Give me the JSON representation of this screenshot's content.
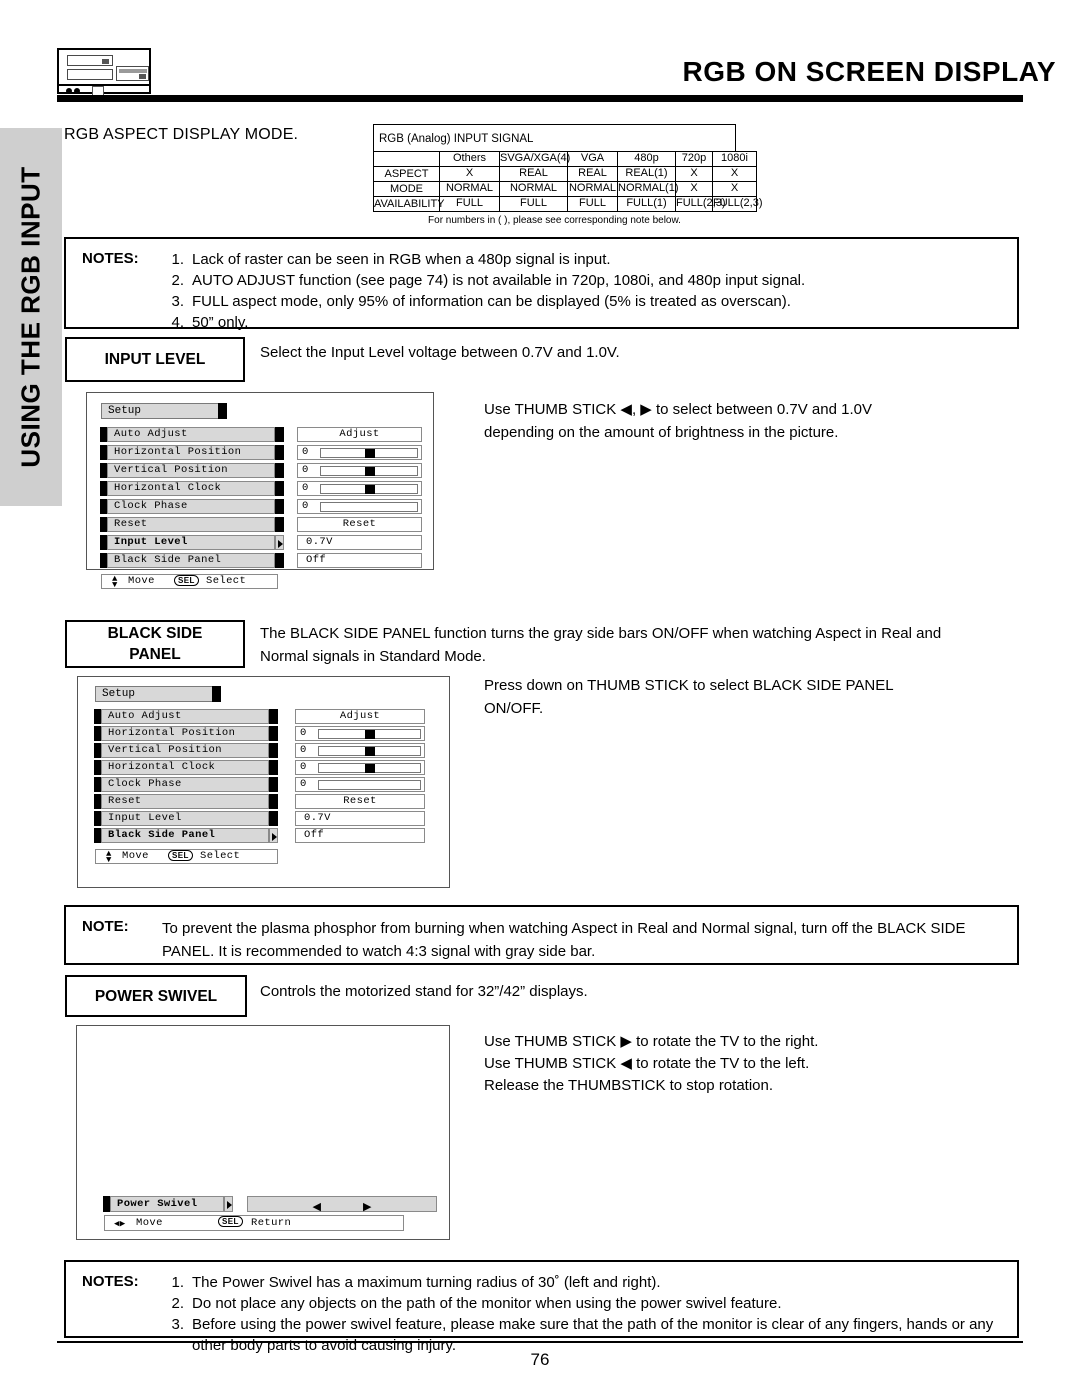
{
  "header": {
    "title": "RGB ON SCREEN DISPLAY",
    "logo_icon": "vcr-deck-icon"
  },
  "sidebar": {
    "tab_label": "USING THE RGB INPUT"
  },
  "aspect_heading": "RGB ASPECT DISPLAY MODE.",
  "signal_table": {
    "title": "RGB (Analog) INPUT SIGNAL",
    "row_label": "ASPECT\nMODE\nAVAILABILITY",
    "row_label_lines": [
      "ASPECT",
      "MODE",
      "AVAILABILITY"
    ],
    "columns": [
      "Others",
      "SVGA/XGA(4)",
      "VGA",
      "480p",
      "720p",
      "1080i"
    ],
    "rows": [
      [
        "X",
        "REAL",
        "REAL",
        "REAL(1)",
        "X",
        "X"
      ],
      [
        "NORMAL",
        "NORMAL",
        "NORMAL",
        "NORMAL(1)",
        "X",
        "X"
      ],
      [
        "FULL",
        "FULL",
        "FULL",
        "FULL(1)",
        "FULL(2,3)",
        "FULL(2,3)"
      ]
    ],
    "footnote": "For numbers in ( ), please see corresponding note below."
  },
  "top_notes": {
    "label": "NOTES:",
    "items": [
      {
        "num": "1.",
        "text": "Lack of raster can be seen in RGB when a 480p signal is input."
      },
      {
        "num": "2.",
        "text": "AUTO ADJUST function (see page 74) is not available in 720p, 1080i, and 480p input signal."
      },
      {
        "num": "3.",
        "text": "FULL aspect mode, only 95% of information can be displayed (5% is treated as overscan)."
      },
      {
        "num": "4.",
        "text": "50” only."
      }
    ]
  },
  "input_level": {
    "label": "INPUT LEVEL",
    "desc": "Select the Input Level voltage between 0.7V and 1.0V.",
    "instruction": "Use THUMB STICK ◀, ▶ to select between 0.7V and 1.0V depending on the amount of brightness in the picture.",
    "osd": {
      "title": "Setup",
      "rows": [
        {
          "label": "Auto Adjust",
          "type": "text",
          "value": "Adjust",
          "selected": false,
          "arrow": false
        },
        {
          "label": "Horizontal Position",
          "type": "slider",
          "value": "0",
          "thumb": 48,
          "selected": false,
          "arrow": false
        },
        {
          "label": "Vertical Position",
          "type": "slider",
          "value": "0",
          "thumb": 48,
          "selected": false,
          "arrow": false
        },
        {
          "label": "Horizontal Clock",
          "type": "slider",
          "value": "0",
          "thumb": 48,
          "selected": false,
          "arrow": false
        },
        {
          "label": "Clock Phase",
          "type": "slider",
          "value": "0",
          "thumb": -1,
          "selected": false,
          "arrow": false
        },
        {
          "label": "Reset",
          "type": "text",
          "value": "Reset",
          "selected": false,
          "arrow": false
        },
        {
          "label": "Input Level",
          "type": "text",
          "value": "0.7V",
          "selected": true,
          "arrow": true
        },
        {
          "label": "Black Side Panel",
          "type": "text",
          "value": "Off",
          "selected": false,
          "arrow": false
        }
      ],
      "footer_move": "Move",
      "footer_key": "SEL",
      "footer_action": "Select"
    }
  },
  "black_side_panel": {
    "label_line1": "BLACK SIDE",
    "label_line2": "PANEL",
    "desc": "The BLACK SIDE PANEL function turns the gray side bars ON/OFF when watching Aspect in Real and Normal signals in Standard Mode.",
    "instruction": "Press down on THUMB STICK to select BLACK SIDE PANEL ON/OFF.",
    "osd": {
      "title": "Setup",
      "rows": [
        {
          "label": "Auto Adjust",
          "type": "text",
          "value": "Adjust",
          "selected": false,
          "arrow": false
        },
        {
          "label": "Horizontal Position",
          "type": "slider",
          "value": "0",
          "thumb": 48,
          "selected": false,
          "arrow": false
        },
        {
          "label": "Vertical Position",
          "type": "slider",
          "value": "0",
          "thumb": 48,
          "selected": false,
          "arrow": false
        },
        {
          "label": "Horizontal Clock",
          "type": "slider",
          "value": "0",
          "thumb": 48,
          "selected": false,
          "arrow": false
        },
        {
          "label": "Clock Phase",
          "type": "slider",
          "value": "0",
          "thumb": -1,
          "selected": false,
          "arrow": false
        },
        {
          "label": "Reset",
          "type": "text",
          "value": "Reset",
          "selected": false,
          "arrow": false
        },
        {
          "label": "Input Level",
          "type": "text",
          "value": "0.7V",
          "selected": false,
          "arrow": false
        },
        {
          "label": "Black Side Panel",
          "type": "text",
          "value": "Off",
          "selected": true,
          "arrow": true
        }
      ],
      "footer_move": "Move",
      "footer_key": "SEL",
      "footer_action": "Select"
    }
  },
  "middle_note": {
    "label": "NOTE:",
    "text": "To prevent the plasma phosphor from burning when watching Aspect in Real and Normal signal, turn off the BLACK SIDE PANEL.  It is recommended to watch 4:3 signal with gray side bar."
  },
  "power_swivel": {
    "label": "POWER SWIVEL",
    "desc": "Controls the motorized stand for 32”/42” displays.",
    "instructions": [
      "Use THUMB STICK ▶ to rotate the TV to the right.",
      "Use THUMB STICK ◀ to rotate the TV to the left.",
      "Release the THUMBSTICK to stop rotation."
    ],
    "osd": {
      "row_label": "Power Swivel",
      "left_arrow": "◀",
      "right_arrow": "▶",
      "footer_move": "Move",
      "footer_key": "SEL",
      "footer_action": "Return"
    }
  },
  "bottom_notes": {
    "label": "NOTES:",
    "items": [
      {
        "num": "1.",
        "text": "The Power Swivel has a maximum turning radius of 30˚ (left and right)."
      },
      {
        "num": "2.",
        "text": "Do not place any objects on the path of the monitor when using the power swivel feature."
      },
      {
        "num": "3.",
        "text": "Before using the power swivel feature, please make sure that the path of the monitor is clear of any fingers, hands or any other body parts to avoid causing injury."
      }
    ]
  },
  "page_number": "76",
  "colors": {
    "sidebar_band": "#cfcfcf",
    "osd_row": "#d8d8d8",
    "rule": "#000000"
  }
}
